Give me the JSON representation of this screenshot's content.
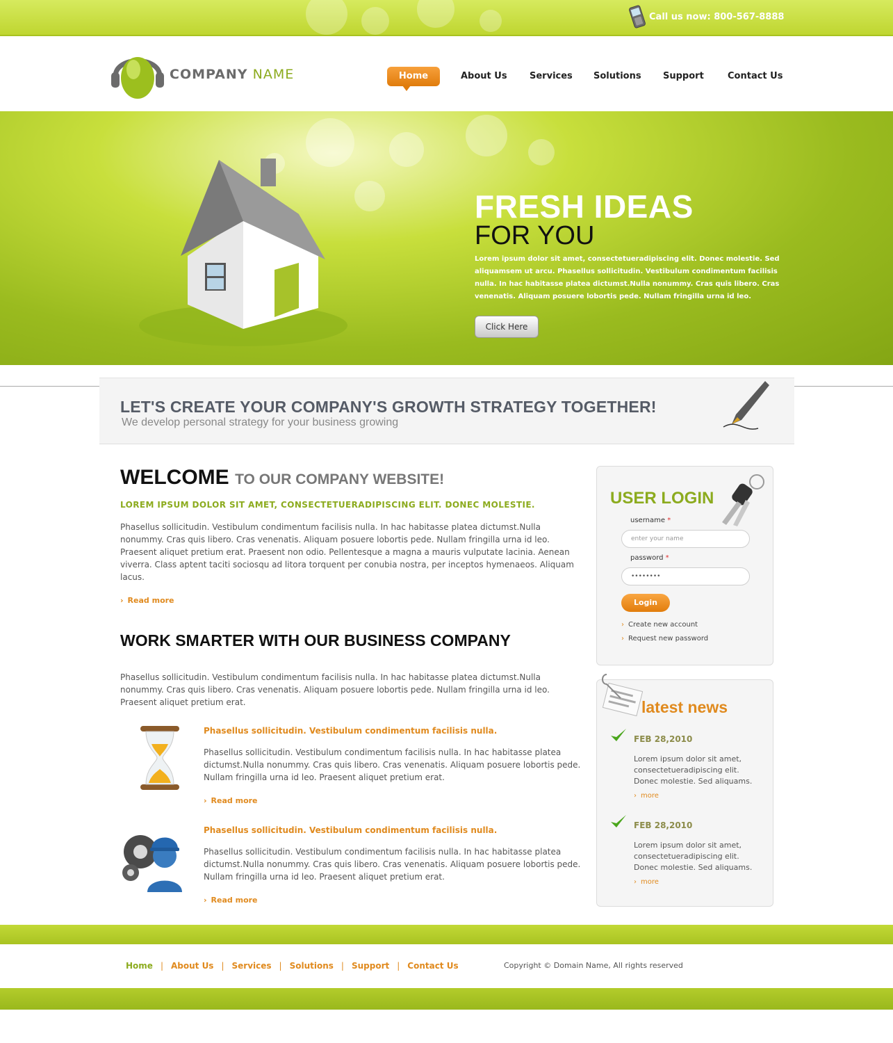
{
  "topbar": {
    "call_text": "Call us now: 800-567-8888",
    "phone_icon": "mobile-phone-icon"
  },
  "header": {
    "brand_part1": "COMPANY",
    "brand_part2": "NAME",
    "logo_icon": "headphones-logo-icon",
    "nav": [
      {
        "label": "Home",
        "active": true
      },
      {
        "label": "About Us"
      },
      {
        "label": "Services"
      },
      {
        "label": "Solutions"
      },
      {
        "label": "Support"
      },
      {
        "label": "Contact Us"
      }
    ]
  },
  "hero": {
    "title": "FRESH IDEAS",
    "subtitle": "FOR YOU",
    "text": "Lorem ipsum dolor sit amet, consectetueradipiscing elit. Donec molestie. Sed aliquamsem ut arcu. Phasellus sollicitudin. Vestibulum condimentum facilisis nulla. In hac habitasse platea dictumst.Nulla nonummy. Cras quis libero. Cras venenatis. Aliquam posuere lobortis pede. Nullam fringilla urna id leo.",
    "button": "Click Here",
    "image_icon": "house-icon"
  },
  "strategy": {
    "title": "LET'S CREATE YOUR COMPANY'S GROWTH STRATEGY TOGETHER!",
    "subtitle": "We develop personal strategy for your business growing",
    "icon": "fountain-pen-icon"
  },
  "main": {
    "welcome_bold": "WELCOME",
    "welcome_rest": "TO OUR COMPANY WEBSITE!",
    "lead": "LOREM IPSUM DOLOR SIT AMET, CONSECTETUERADIPISCING ELIT. DONEC MOLESTIE.",
    "welcome_lines": [
      "Phasellus sollicitudin. Vestibulum condimentum facilisis nulla. In hac habitasse platea dictumst.Nulla",
      "nonummy. Cras quis libero. Cras venenatis. Aliquam posuere lobortis pede. Nullam fringilla urna id leo.",
      "Praesent aliquet pretium erat. Praesent non odio. Pellentesque a magna a mauris vulputate lacinia. Aenean",
      "viverra. Class aptent taciti sociosqu ad litora torquent per conubia nostra, per inceptos hymenaeos. Aliquam",
      "lacus."
    ],
    "read_more": "Read more",
    "work_title": "WORK SMARTER WITH OUR BUSINESS COMPANY",
    "work_lines": [
      "Phasellus sollicitudin. Vestibulum condimentum facilisis nulla. In hac habitasse platea dictumst.Nulla",
      "nonummy. Cras quis libero. Cras venenatis. Aliquam posuere lobortis pede. Nullam fringilla urna id leo.",
      "Praesent aliquet pretium erat."
    ],
    "features": [
      {
        "title": "Phasellus sollicitudin. Vestibulum condimentum facilisis nulla.",
        "lines": [
          "Phasellus sollicitudin. Vestibulum condimentum facilisis nulla. In hac habitasse platea",
          "dictumst.Nulla nonummy. Cras quis libero. Cras venenatis. Aliquam posuere lobortis pede.",
          "Nullam fringilla urna id leo. Praesent aliquet pretium erat."
        ],
        "read_more": "Read more",
        "icon": "hourglass-icon"
      },
      {
        "title": "Phasellus sollicitudin. Vestibulum condimentum facilisis nulla.",
        "lines": [
          "Phasellus sollicitudin. Vestibulum condimentum facilisis nulla. In hac habitasse platea",
          "dictumst.Nulla nonummy. Cras quis libero. Cras venenatis. Aliquam posuere lobortis pede.",
          "Nullam fringilla urna id leo. Praesent aliquet pretium erat."
        ],
        "read_more": "Read more",
        "icon": "worker-gears-icon"
      }
    ]
  },
  "login": {
    "title": "USER LOGIN",
    "username_label": "username",
    "username_placeholder": "enter your name",
    "password_label": "password",
    "password_value": "••••••••",
    "required_mark": "*",
    "button": "Login",
    "create_account": "Create new account",
    "request_password": "Request new password",
    "icon": "keys-icon"
  },
  "news": {
    "title": "latest news",
    "icon": "newspaper-clip-icon",
    "items": [
      {
        "date": "FEB 28,2010",
        "lines": [
          "Lorem ipsum dolor sit amet,",
          "consectetueradipiscing elit.",
          "Donec molestie. Sed aliquams."
        ],
        "more": "more"
      },
      {
        "date": "FEB 28,2010",
        "lines": [
          "Lorem ipsum dolor sit amet,",
          "consectetueradipiscing elit.",
          "Donec molestie. Sed aliquams."
        ],
        "more": "more"
      }
    ]
  },
  "footer": {
    "links": [
      "Home",
      "About Us",
      "Services",
      "Solutions",
      "Support",
      "Contact Us"
    ],
    "separator": "|",
    "copyright": "Copyright © Domain Name, All rights reserved"
  },
  "colors": {
    "green": "#8cab1e",
    "orange": "#e08a1e",
    "lime": "#c2d936"
  }
}
